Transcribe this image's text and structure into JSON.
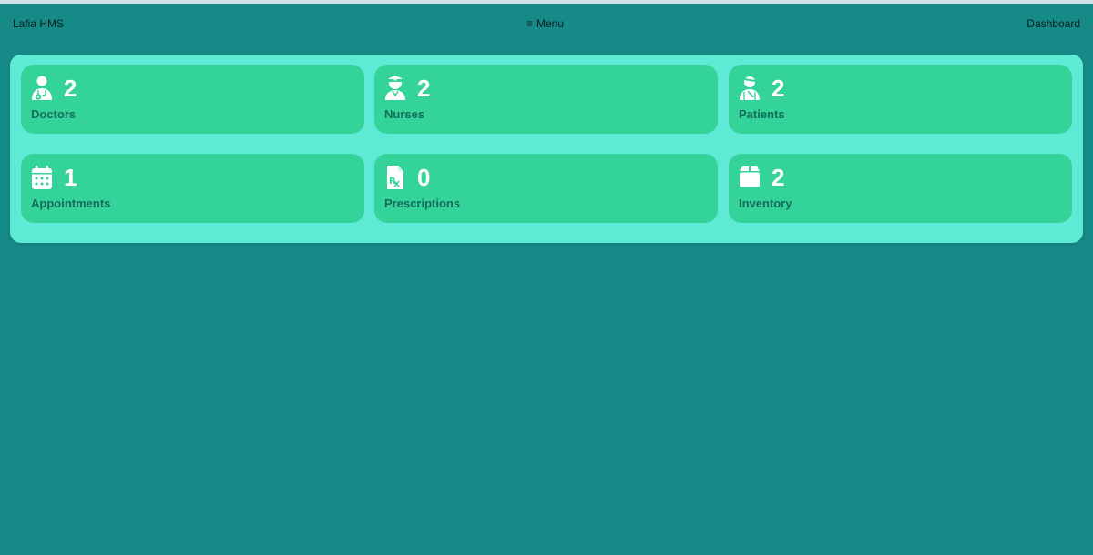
{
  "navbar": {
    "brand": "Lafia HMS",
    "menu_glyph": "≡",
    "menu_label": "Menu",
    "dashboard_label": "Dashboard"
  },
  "cards": [
    {
      "label": "Doctors",
      "count": "2",
      "icon": "doctor-icon"
    },
    {
      "label": "Nurses",
      "count": "2",
      "icon": "nurse-icon"
    },
    {
      "label": "Patients",
      "count": "2",
      "icon": "patient-icon"
    },
    {
      "label": "Appointments",
      "count": "1",
      "icon": "calendar-icon"
    },
    {
      "label": "Prescriptions",
      "count": "0",
      "icon": "prescription-icon"
    },
    {
      "label": "Inventory",
      "count": "2",
      "icon": "box-icon"
    }
  ],
  "colors": {
    "background": "#168a87",
    "panel": "#5eead4",
    "card": "#34d399",
    "card_label": "#166b5a",
    "count_text": "#ffffff"
  }
}
